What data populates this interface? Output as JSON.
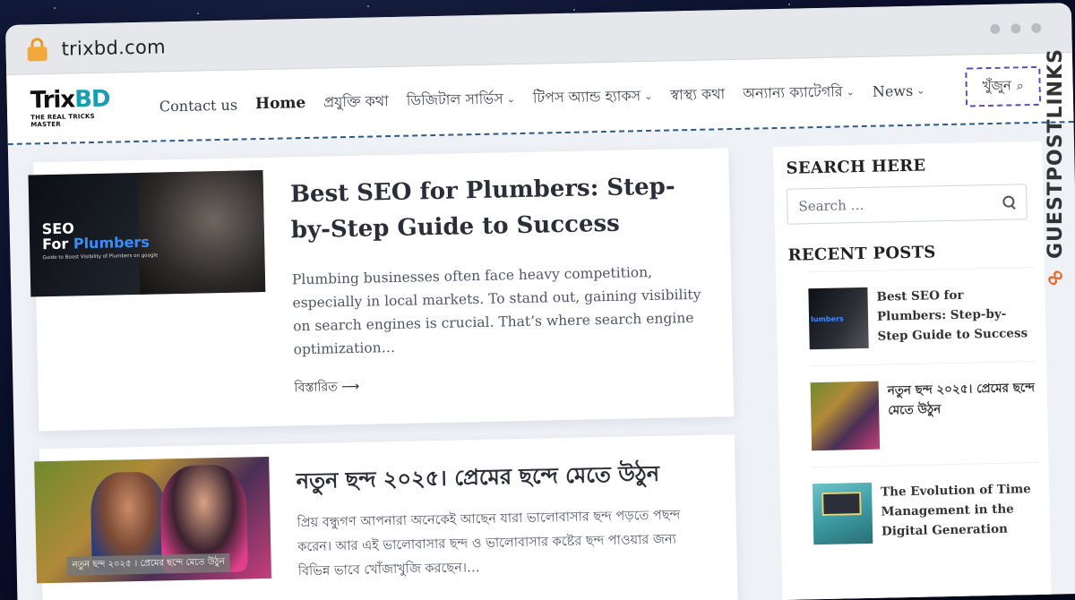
{
  "browser": {
    "url": "trixbd.com"
  },
  "site": {
    "logo_main": "Trix",
    "logo_accent": "BD",
    "logo_tagline": "THE REAL TRICKS MASTER",
    "nav": [
      {
        "label": "Contact us",
        "dropdown": false
      },
      {
        "label": "Home",
        "dropdown": false,
        "active": true
      },
      {
        "label": "প্রযুক্তি কথা",
        "dropdown": false
      },
      {
        "label": "ডিজিটাল সার্ভিস",
        "dropdown": true
      },
      {
        "label": "টিপস অ্যান্ড হ্যাকস",
        "dropdown": true
      },
      {
        "label": "স্বাস্থ্য কথা",
        "dropdown": false
      },
      {
        "label": "অন্যান্য ক্যাটেগরি",
        "dropdown": true
      },
      {
        "label": "News",
        "dropdown": true
      }
    ],
    "search_button": "খুঁজুন"
  },
  "posts": [
    {
      "title": "Best SEO for Plumbers: Step-by-Step Guide to Success",
      "excerpt": "Plumbing businesses often face heavy competition, especially in local markets. To stand out, gaining visibility on search engines is crucial. That’s where search engine optimization…",
      "read_more": "বিস্তারিত",
      "thumb_line1": "SEO",
      "thumb_line2a": "For ",
      "thumb_line2b": "Plumbers",
      "thumb_sub": "Guide to Boost Visibility of Plumbers on google"
    },
    {
      "title": "নতুন ছন্দ ২০২৫। প্রেমের ছন্দে মেতে উঠুন",
      "excerpt": "প্রিয় বন্ধুগণ আপনারা অনেকেই আছেন যারা ভালোবাসার ছন্দ পড়তে পছন্দ করেন। আর এই ভালোবাসার ছন্দ ও ভালোবাসার কষ্টের ছন্দ পাওয়ার জন্য বিভিন্ন ভাবে খোঁজাখুজি করছেন।…",
      "thumb_caption": "নতুন ছন্দ ২০২৫ । প্রেমের ছন্দে মেতে উঠুন"
    }
  ],
  "sidebar": {
    "search_title": "SEARCH HERE",
    "search_placeholder": "Search …",
    "recent_title": "RECENT POSTS",
    "recent": [
      {
        "title": "Best SEO for Plumbers: Step-by-Step Guide to Success",
        "thumb_text": "lumbers"
      },
      {
        "title": "নতুন ছন্দ ২০২৫। প্রেমের ছন্দে মেতে উঠুন"
      },
      {
        "title": "The Evolution of Time Management in the Digital Generation"
      }
    ]
  },
  "watermark": {
    "text": "GUESTPOSTLINKS"
  },
  "icons": {
    "lock": "lock-icon",
    "search": "search-icon",
    "chevron": "chevron-down-icon",
    "arrow": "arrow-right-icon",
    "link": "link-icon"
  },
  "colors": {
    "brand_accent": "#1a9cb3",
    "lock": "#f2a93b",
    "watermark_accent": "#e96a2b",
    "header_dash": "#2d5a86"
  }
}
